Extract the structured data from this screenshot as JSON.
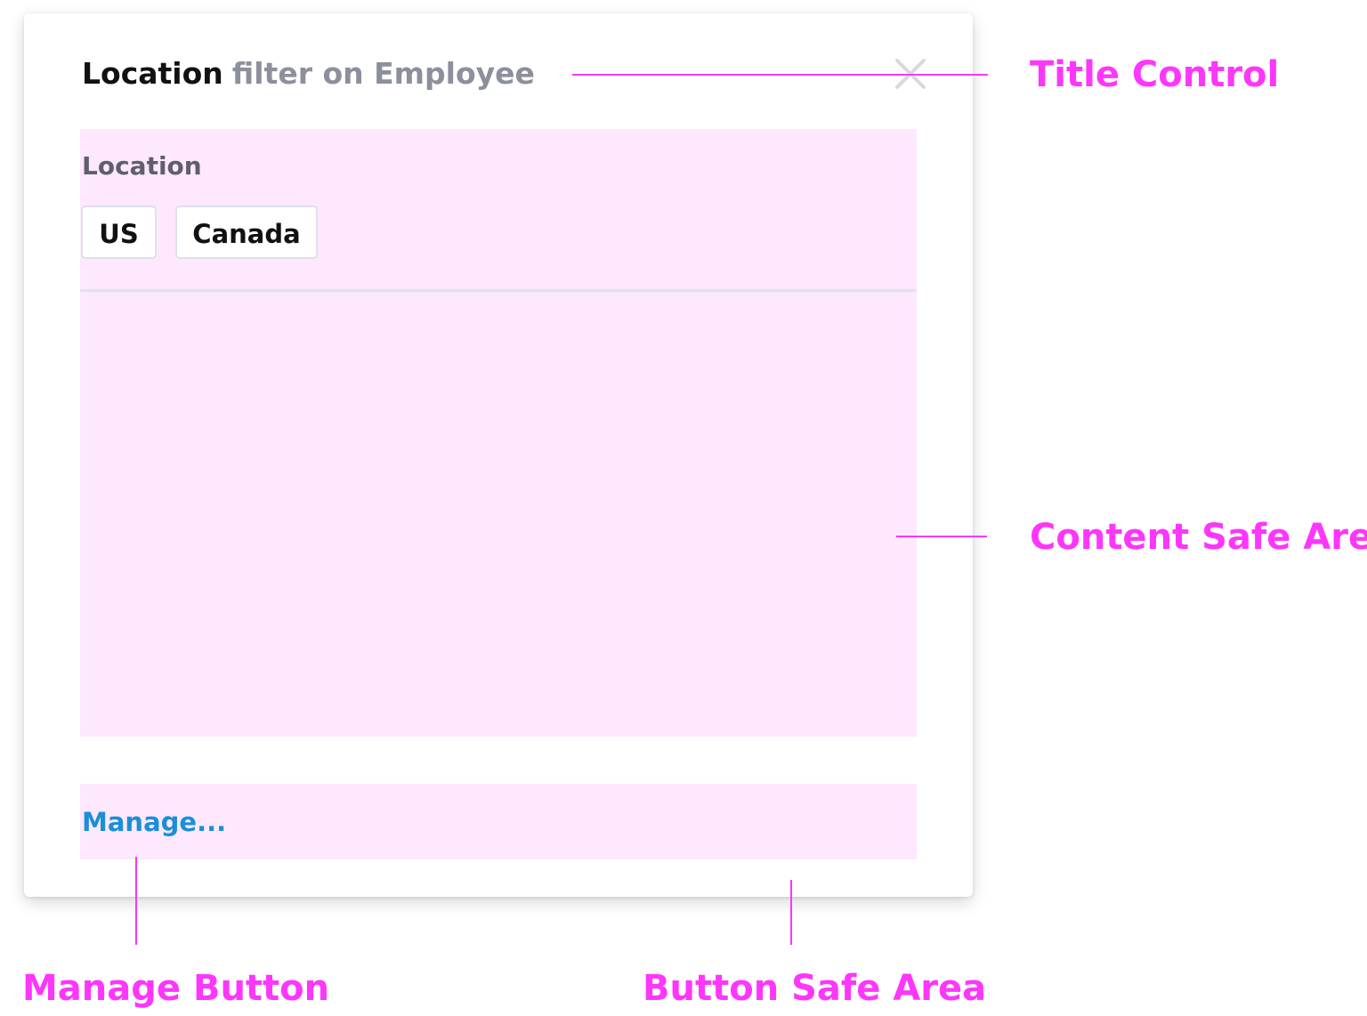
{
  "dialog": {
    "title": "Location",
    "subtitle": "filter on Employee",
    "field_label": "Location",
    "chips": [
      "US",
      "Canada"
    ],
    "manage_label": "Manage..."
  },
  "annotations": {
    "title_control": "Title Control",
    "content_safe_area": "Content Safe Area",
    "manage_button": "Manage Button",
    "button_safe_area": "Button Safe Area"
  },
  "colors": {
    "annotation": "#fd36fb",
    "safe_area_fill": "#fde8fd",
    "link": "#1b8fd6",
    "subtitle": "#8c909c"
  },
  "icons": {
    "close": "close-icon"
  }
}
